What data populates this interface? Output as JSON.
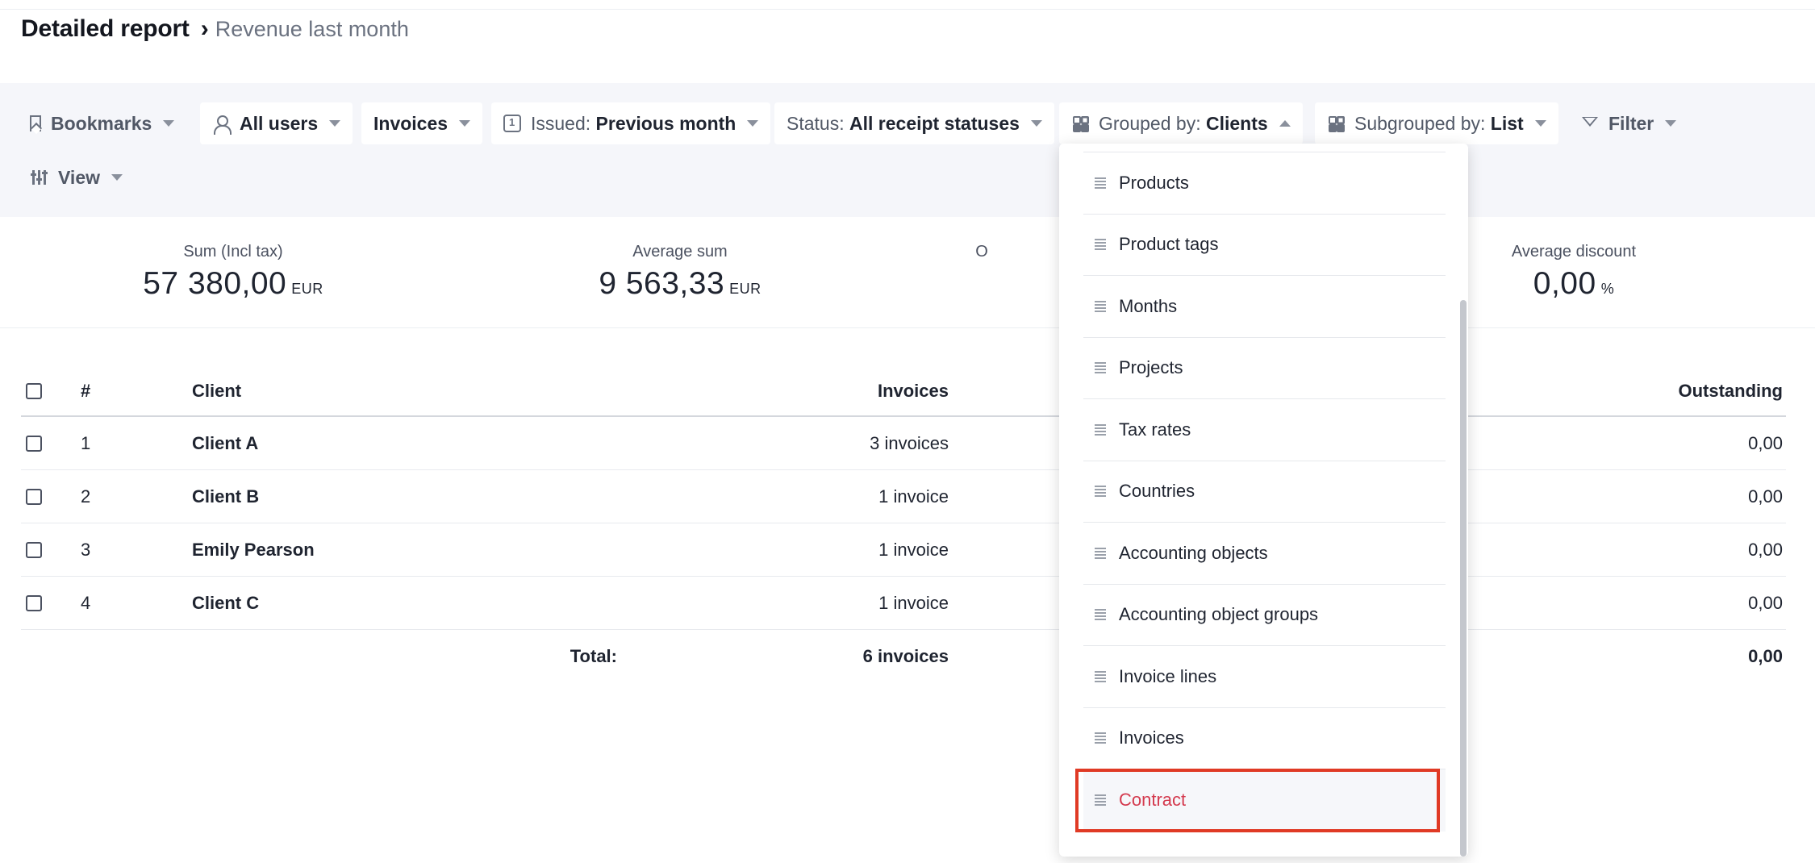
{
  "header": {
    "title": "Detailed report",
    "separator": "›",
    "subtitle": "Revenue last month"
  },
  "toolbar": {
    "bookmarks": "Bookmarks",
    "users": "All users",
    "document_type": "Invoices",
    "issued_label": "Issued:",
    "issued_value": "Previous month",
    "status_label": "Status:",
    "status_value": "All receipt statuses",
    "grouped_label": "Grouped by:",
    "grouped_value": "Clients",
    "subgrouped_label": "Subgrouped by:",
    "subgrouped_value": "List",
    "filter": "Filter",
    "view": "View"
  },
  "metrics": [
    {
      "label": "Sum (Incl tax)",
      "value": "57 380,00",
      "unit": "EUR"
    },
    {
      "label": "Average sum",
      "value": "9 563,33",
      "unit": "EUR"
    },
    {
      "label": "O",
      "value": "",
      "unit": ""
    },
    {
      "label": "Average discount",
      "value": "0,00",
      "unit": "%"
    }
  ],
  "table": {
    "headers": {
      "num": "#",
      "client": "Client",
      "invoices": "Invoices",
      "outstanding": "Outstanding"
    },
    "rows": [
      {
        "num": "1",
        "client": "Client A",
        "invoices": "3 invoices",
        "outstanding": "0,00"
      },
      {
        "num": "2",
        "client": "Client B",
        "invoices": "1 invoice",
        "outstanding": "0,00"
      },
      {
        "num": "3",
        "client": "Emily Pearson",
        "invoices": "1 invoice",
        "outstanding": "0,00"
      },
      {
        "num": "4",
        "client": "Client C",
        "invoices": "1 invoice",
        "outstanding": "0,00"
      }
    ],
    "total": {
      "label": "Total:",
      "invoices": "6 invoices",
      "outstanding": "0,00"
    }
  },
  "dropdown": {
    "items": [
      {
        "label": "Products"
      },
      {
        "label": "Product tags"
      },
      {
        "label": "Months"
      },
      {
        "label": "Projects"
      },
      {
        "label": "Tax rates"
      },
      {
        "label": "Countries"
      },
      {
        "label": "Accounting objects"
      },
      {
        "label": "Accounting object groups"
      },
      {
        "label": "Invoice lines"
      },
      {
        "label": "Invoices"
      },
      {
        "label": "Contract"
      }
    ],
    "selected_index": 10,
    "highlight_color": "#e03a25",
    "selected_text_color": "#d43a4e"
  }
}
